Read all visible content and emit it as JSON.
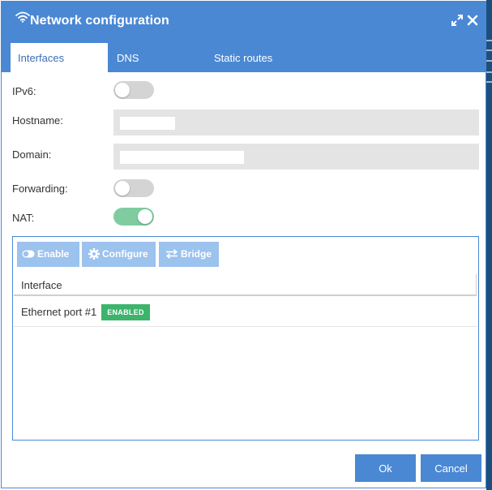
{
  "dialog": {
    "title": "Network configuration",
    "icons": {
      "title": "wifi-icon",
      "maximize": "maximize-icon",
      "close": "close-icon"
    }
  },
  "tabs": [
    {
      "label": "Interfaces",
      "active": true
    },
    {
      "label": "DNS",
      "active": false
    },
    {
      "label": "Static routes",
      "active": false
    }
  ],
  "form": {
    "ipv6": {
      "label": "IPv6:",
      "enabled": false
    },
    "hostname": {
      "label": "Hostname:",
      "value": ""
    },
    "domain": {
      "label": "Domain:",
      "value": ""
    },
    "forwarding": {
      "label": "Forwarding:",
      "enabled": false
    },
    "nat": {
      "label": "NAT:",
      "enabled": true
    }
  },
  "grid": {
    "toolbar": {
      "enable_label": "Enable",
      "configure_label": "Configure",
      "bridge_label": "Bridge"
    },
    "columns": [
      "Interface"
    ],
    "rows": [
      {
        "name": "Ethernet port #1",
        "status": "ENABLED"
      }
    ]
  },
  "footer": {
    "ok_label": "Ok",
    "cancel_label": "Cancel"
  },
  "colors": {
    "accent": "#4a88d4",
    "button_light": "#9cc2ee",
    "toggle_on": "#7fcca0",
    "badge_enabled": "#3cb46c"
  }
}
